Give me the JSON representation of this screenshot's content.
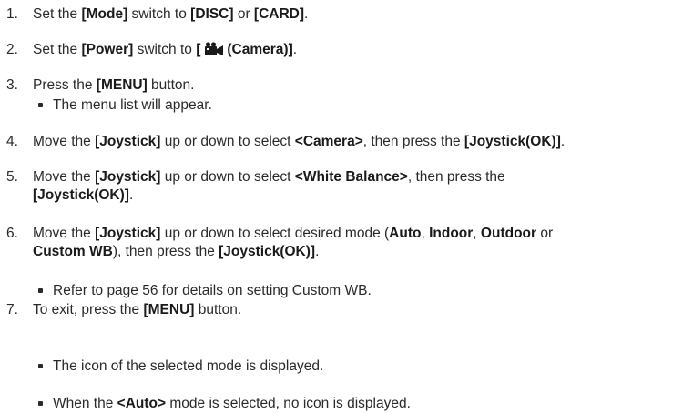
{
  "steps": [
    {
      "num": "1.",
      "t1": "Set the ",
      "b1": "[Mode]",
      "t2": " switch to ",
      "b2": "[DISC]",
      "t3": " or ",
      "b3": "[CARD]",
      "t4": "."
    },
    {
      "num": "2.",
      "t1": "Set the ",
      "b1": "[Power]",
      "t2": " switch to ",
      "b2": "[",
      "icon": "camera-icon",
      "b3": "(Camera)]",
      "t3": "."
    },
    {
      "num": "3.",
      "t1": "Press the ",
      "b1": "[MENU]",
      "t2": " button.",
      "bullets": [
        "The menu list will appear."
      ]
    },
    {
      "num": "4.",
      "t1": "Move the ",
      "b1": "[Joystick]",
      "t2": " up or down to select ",
      "b2": "<Camera>",
      "t3": ", then press the ",
      "b3": "[Joystick(OK)]",
      "t4": "."
    },
    {
      "num": "5.",
      "t1": "Move the ",
      "b1": "[Joystick]",
      "t2": " up or down to select ",
      "b2": "<White Balance>",
      "t3": ", then press the",
      "b3": "[Joystick(OK)]",
      "t4": "."
    },
    {
      "num": "6.",
      "t1": "Move the ",
      "b1": "[Joystick]",
      "t2": " up or down to select desired mode (",
      "b2": "Auto",
      "t3": ", ",
      "b3": "Indoor",
      "t4": ", ",
      "b4": "Outdoor",
      "t5": " or",
      "b5": "Custom WB",
      "t6": "), then press the ",
      "b6": "[Joystick(OK)]",
      "t7": ".",
      "bullets": [
        "Refer to page 56 for details on setting Custom WB."
      ]
    },
    {
      "num": "7.",
      "t1": "To exit, press the ",
      "b1": "[MENU]",
      "t2": " button.",
      "bullets": [
        "The icon of the selected mode is displayed.",
        "When the ",
        "<Auto>",
        " mode is selected, no icon is displayed."
      ]
    }
  ],
  "colors": {
    "text": "#2a2a2a",
    "bold": "#1a1a1a",
    "background": "#ffffff"
  }
}
